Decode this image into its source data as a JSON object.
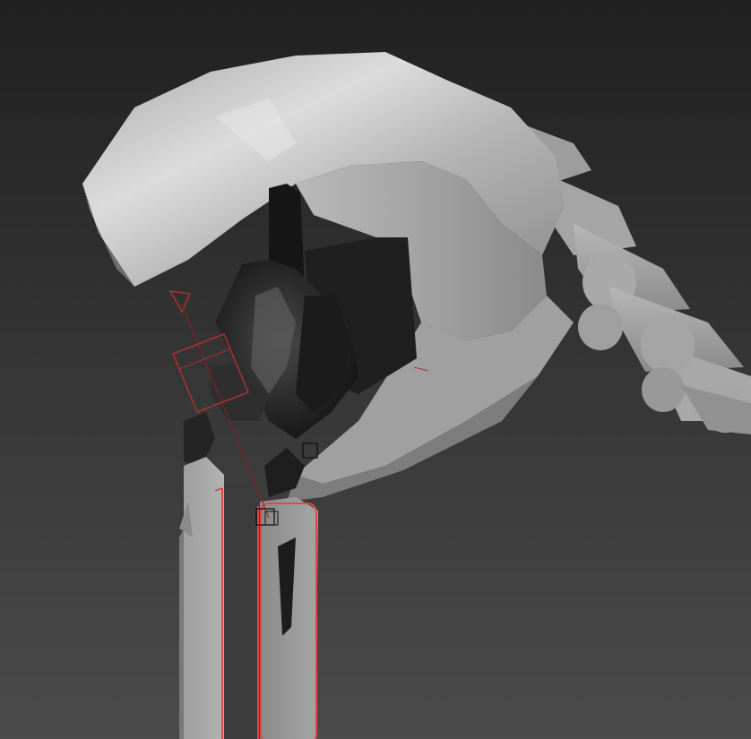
{
  "viewport": {
    "background_top": "#212121",
    "background_bottom": "#4a4a4a",
    "selection_color": "#e04545",
    "gizmo_line_color": "#9a2222",
    "model_dark": "#1e1e1e",
    "model_light": "#c8c8c8"
  }
}
